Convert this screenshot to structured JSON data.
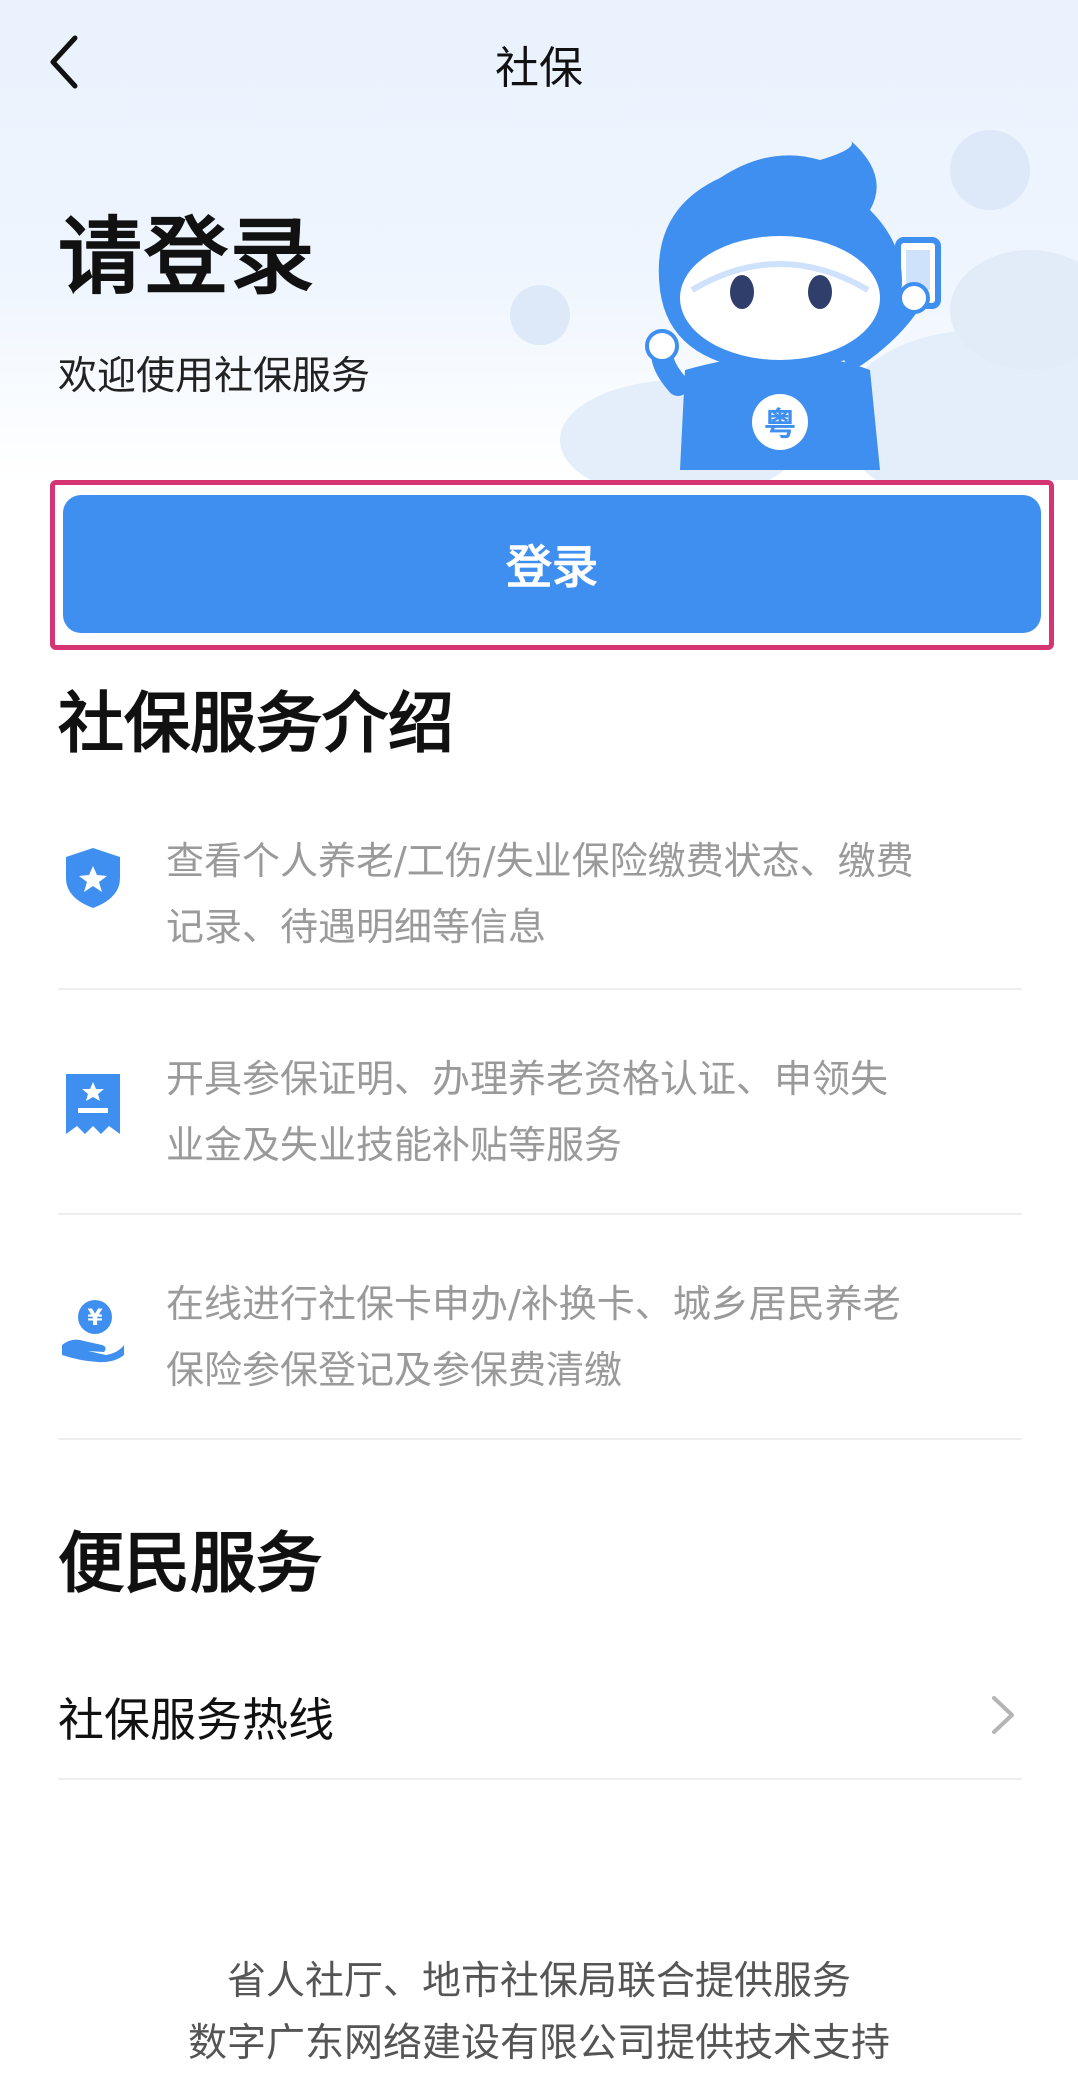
{
  "header": {
    "title": "社保",
    "back_icon": "chevron-left-icon"
  },
  "hero": {
    "title": "请登录",
    "subtitle": "欢迎使用社保服务",
    "mascot": "mascot-illustration",
    "mascot_badge": "粤"
  },
  "login": {
    "label": "登录",
    "accent": "#3f8ff0",
    "highlight": "#d63573"
  },
  "intro": {
    "title": "社保服务介绍",
    "items": [
      {
        "icon": "shield-star-icon",
        "lines": [
          "查看个人养老/工伤/失业保险缴费状态、缴费",
          "记录、待遇明细等信息"
        ]
      },
      {
        "icon": "certificate-icon",
        "lines": [
          "开具参保证明、办理养老资格认证、申领失",
          "业金及失业技能补贴等服务"
        ]
      },
      {
        "icon": "hand-coin-icon",
        "coin_symbol": "¥",
        "lines": [
          "在线进行社保卡申办/补换卡、城乡居民养老",
          "保险参保登记及参保费清缴"
        ]
      }
    ]
  },
  "convenience": {
    "title": "便民服务",
    "hotline": {
      "label": "社保服务热线",
      "icon": "chevron-right-icon"
    }
  },
  "footer": {
    "line1": "省人社厅、地市社保局联合提供服务",
    "line2": "数字广东网络建设有限公司提供技术支持"
  }
}
